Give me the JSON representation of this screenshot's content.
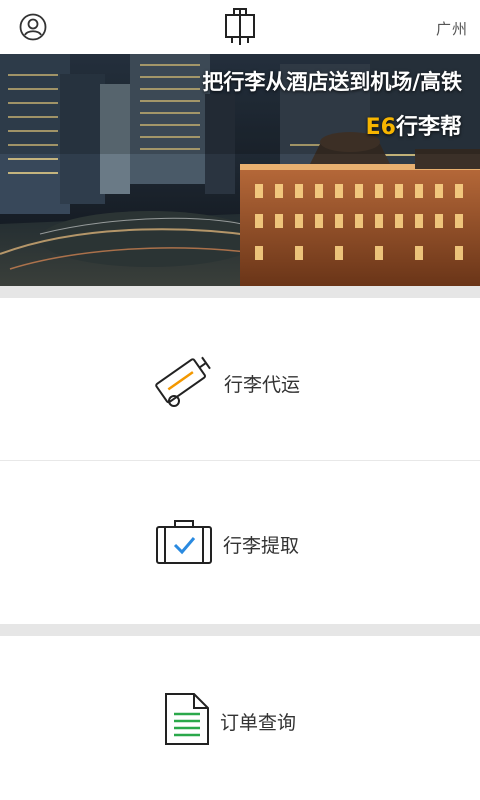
{
  "header": {
    "user_icon": "user-circle-icon",
    "logo_icon": "luggage-logo-icon",
    "city": "广州"
  },
  "banner": {
    "headline": "把行李从酒店送到机场/高铁",
    "brand_accent": "E6",
    "brand_text": "行李帮"
  },
  "menu": [
    {
      "label": "行李代运",
      "icon": "luggage-trolley-icon"
    },
    {
      "label": "行李提取",
      "icon": "suitcase-check-icon"
    },
    {
      "label": "订单查询",
      "icon": "document-list-icon"
    }
  ],
  "colors": {
    "accent_orange": "#f39800",
    "check_blue": "#2a8ae0",
    "doc_green": "#2aa84a",
    "brand_yellow": "#f7b500",
    "section_gap": "#e6e6e6"
  }
}
